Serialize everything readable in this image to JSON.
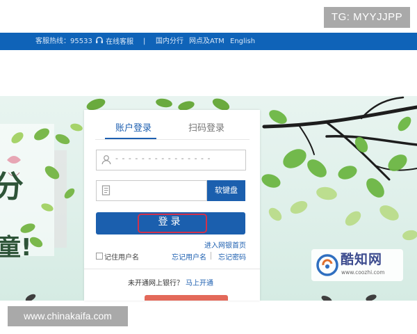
{
  "topbar": {
    "hotline": "客服热线：95533",
    "online_service": "在线客服",
    "separator": "|",
    "domestic_branches": "国内分行",
    "outlets_atm": "网点及ATM",
    "english": "English"
  },
  "watermarks": {
    "top": "TG: MYYJJPP",
    "bottom": "www.chinakaifa.com"
  },
  "banner": {
    "char_left": "分",
    "char_left_bottom": "童!"
  },
  "login": {
    "tabs": [
      {
        "label": "账户登录",
        "active": true
      },
      {
        "label": "扫码登录",
        "active": false
      }
    ],
    "username_value": "- - - - - - - - - - - - - - -",
    "keyboard_label": "软键盘",
    "login_label": "登录",
    "home_link": "进入网银首页",
    "remember_label": "记住用户名",
    "forgot_username": "忘记用户名",
    "forgot_password": "忘记密码",
    "promo_text": "未开通网上银行？",
    "promo_link": "马上开通"
  },
  "logo": {
    "name": "酷知网",
    "url": "www.coozhi.com"
  },
  "colors": {
    "brand_blue": "#0f63b8",
    "button_blue": "#1b5fae",
    "highlight_red": "#d2314b"
  }
}
